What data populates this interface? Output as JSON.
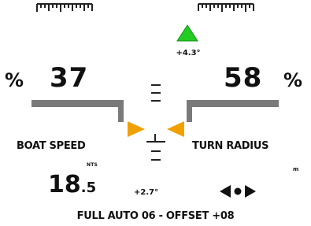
{
  "rudder_delta": "+4.3°",
  "left_gauge": {
    "unit": "%",
    "value": "37",
    "fill_fraction": 0.37
  },
  "right_gauge": {
    "unit": "%",
    "value": "58",
    "fill_fraction": 0.58
  },
  "boat_speed": {
    "label": "BOAT SPEED",
    "unit": "NTS",
    "integer": "18",
    "decimal": ".5"
  },
  "turn_radius": {
    "label": "TURN RADIUS",
    "unit": "m"
  },
  "heading_offset": "+2.7°",
  "status": "FULL AUTO 06 - OFFSET +08",
  "colors": {
    "up_arrow": "#22cc22",
    "steer_arrows": "#f0a000",
    "bar": "#7a7a7a"
  },
  "icons": {
    "up_arrow": "triangle-up",
    "steer_left": "triangle-right",
    "steer_right": "triangle-left",
    "nav": "left-dot-right"
  }
}
